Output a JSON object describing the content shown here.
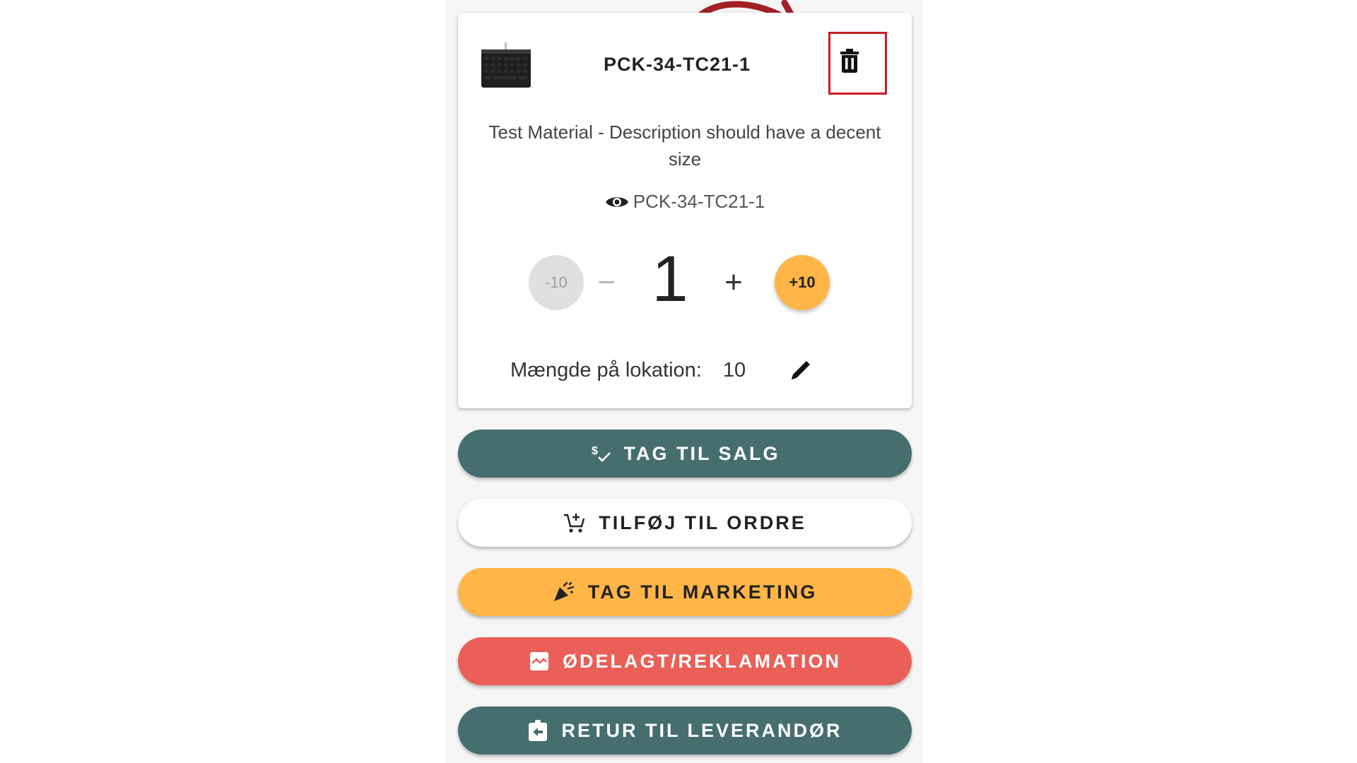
{
  "product": {
    "sku": "PCK-34-TC21-1",
    "description": "Test Material - Description should have a decent size",
    "scan_code": "PCK-34-TC21-1",
    "thumbnail_icon": "keyboard-image"
  },
  "quantity": {
    "minus10_label": "-10",
    "minus_label": "−",
    "value": "1",
    "plus_label": "+",
    "plus10_label": "+10"
  },
  "location": {
    "label": "Mængde på lokation:",
    "value": "10"
  },
  "actions": [
    {
      "label": "TAG TIL SALG",
      "icon": "price-check-icon"
    },
    {
      "label": "TILFØJ TIL ORDRE",
      "icon": "add-cart-icon"
    },
    {
      "label": "TAG TIL MARKETING",
      "icon": "celebration-icon"
    },
    {
      "label": "ØDELAGT/REKLAMATION",
      "icon": "broken-image-icon"
    },
    {
      "label": "RETUR TIL LEVERANDØR",
      "icon": "assignment-return-icon"
    }
  ],
  "colors": {
    "teal": "#466e6f",
    "orange": "#ffb547",
    "red": "#ea5f57",
    "highlight": "#c81d25",
    "annotation_arrow": "#a31f24"
  }
}
